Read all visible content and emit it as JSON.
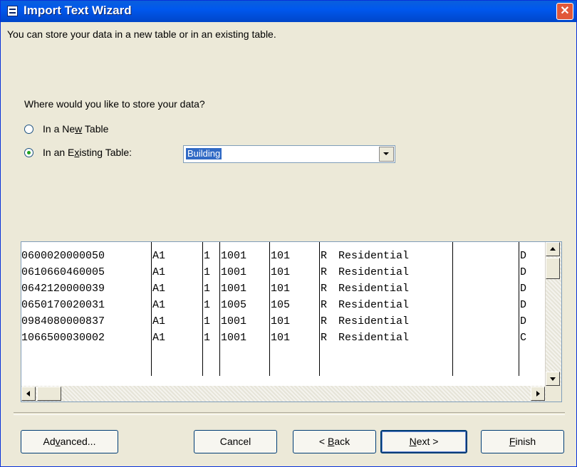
{
  "window": {
    "title": "Import Text Wizard",
    "icon": "table-icon",
    "close_glyph": "✕"
  },
  "intro_text": "You can store your data in a new table or in an existing table.",
  "question_text": "Where would you like to store your data?",
  "options": {
    "new_table": {
      "label_pre": "In a Ne",
      "label_mnemonic": "w",
      "label_post": " Table",
      "checked": false
    },
    "existing_table": {
      "label_pre": "In an E",
      "label_mnemonic": "x",
      "label_post": "isting Table:",
      "checked": true
    }
  },
  "table_select": {
    "value": "Building"
  },
  "preview": {
    "rows": [
      [
        "0600020000050",
        "A1",
        "1",
        "1001",
        "101",
        "R",
        "Residential",
        "",
        "D"
      ],
      [
        "0610660460005",
        "A1",
        "1",
        "1001",
        "101",
        "R",
        "Residential",
        "",
        "D"
      ],
      [
        "0642120000039",
        "A1",
        "1",
        "1001",
        "101",
        "R",
        "Residential",
        "",
        "D"
      ],
      [
        "0650170020031",
        "A1",
        "1",
        "1005",
        "105",
        "R",
        "Residential",
        "",
        "D"
      ],
      [
        "0984080000837",
        "A1",
        "1",
        "1001",
        "101",
        "R",
        "Residential",
        "",
        "D"
      ],
      [
        "1066500030002",
        "A1",
        "1",
        "1001",
        "101",
        "R",
        "Residential",
        "",
        "C"
      ]
    ]
  },
  "buttons": {
    "advanced": {
      "pre": "Ad",
      "mnemonic": "v",
      "post": "anced..."
    },
    "cancel": {
      "pre": "Cancel",
      "mnemonic": "",
      "post": ""
    },
    "back": {
      "pre": "< ",
      "mnemonic": "B",
      "post": "ack"
    },
    "next": {
      "pre": "",
      "mnemonic": "N",
      "post": "ext >"
    },
    "finish": {
      "pre": "",
      "mnemonic": "F",
      "post": "inish"
    }
  }
}
